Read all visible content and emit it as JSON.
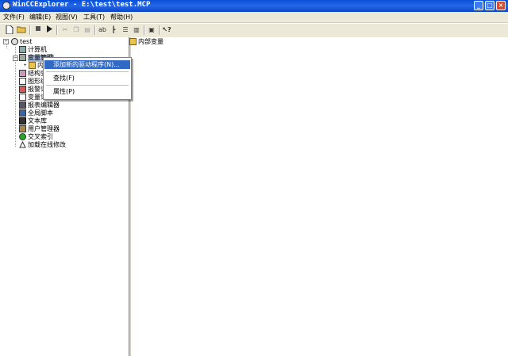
{
  "window": {
    "title": "WinCCExplorer - E:\\test\\test.MCP"
  },
  "menu": [
    "文件(F)",
    "编辑(E)",
    "视图(V)",
    "工具(T)",
    "帮助(H)"
  ],
  "toolbar": {
    "buttons": [
      "new-icon",
      "open-icon",
      "stop-icon",
      "run-icon",
      "cut-icon",
      "copy-icon",
      "paste-icon",
      "font-icon",
      "tree-icon",
      "list-icon",
      "details-icon",
      "properties-icon",
      "help-icon"
    ]
  },
  "tree": {
    "root": "test",
    "items": [
      {
        "label": "计算机",
        "icon": "computer-icon"
      },
      {
        "label": "变量管理",
        "icon": "tags-icon"
      },
      {
        "label": "内部变量",
        "icon": "internal-tag-icon"
      },
      {
        "label": "结构变量",
        "icon": "struct-icon"
      },
      {
        "label": "图形编辑器",
        "icon": "graphics-icon"
      },
      {
        "label": "报警记录",
        "icon": "alarm-icon"
      },
      {
        "label": "变量记录",
        "icon": "tag-log-icon"
      },
      {
        "label": "报表编辑器",
        "icon": "report-icon"
      },
      {
        "label": "全局脚本",
        "icon": "script-icon"
      },
      {
        "label": "文本库",
        "icon": "text-lib-icon"
      },
      {
        "label": "用户管理器",
        "icon": "user-icon"
      },
      {
        "label": "交叉索引",
        "icon": "cross-ref-icon"
      },
      {
        "label": "加载在线修改",
        "icon": "load-online-icon"
      }
    ]
  },
  "context_menu": {
    "items": [
      "添加新的驱动程序(N)...",
      "查找(F)",
      "属性(P)"
    ]
  },
  "right_pane": {
    "items": [
      "内部变量"
    ]
  }
}
